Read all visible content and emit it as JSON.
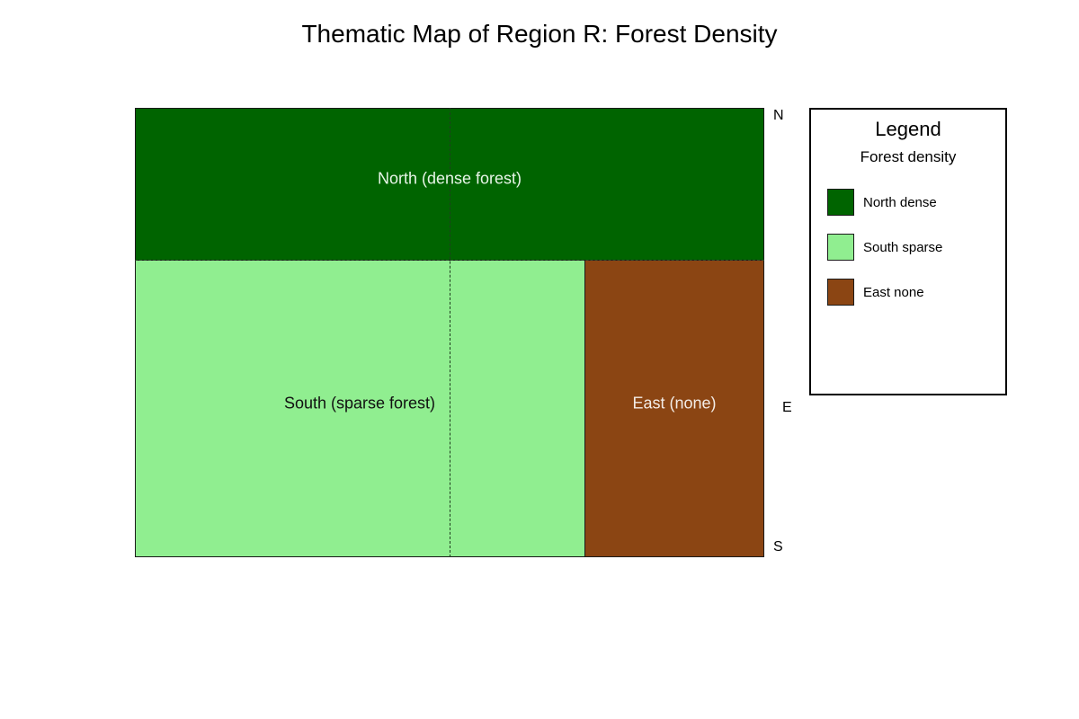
{
  "title": "Thematic Map of Region R: Forest Density",
  "map": {
    "regions": [
      {
        "id": "north",
        "label": "North (dense forest)",
        "color": "#006400"
      },
      {
        "id": "south",
        "label": "South (sparse forest)",
        "color": "#90EE90"
      },
      {
        "id": "east",
        "label": "East (none)",
        "color": "#8B4513"
      }
    ],
    "compass": {
      "north": "N",
      "east": "E",
      "south": "S"
    }
  },
  "legend": {
    "title": "Legend",
    "subtitle": "Forest density",
    "items": [
      {
        "label": "North dense",
        "color": "#006400"
      },
      {
        "label": "South sparse",
        "color": "#90EE90"
      },
      {
        "label": "East none",
        "color": "#8B4513"
      }
    ]
  }
}
